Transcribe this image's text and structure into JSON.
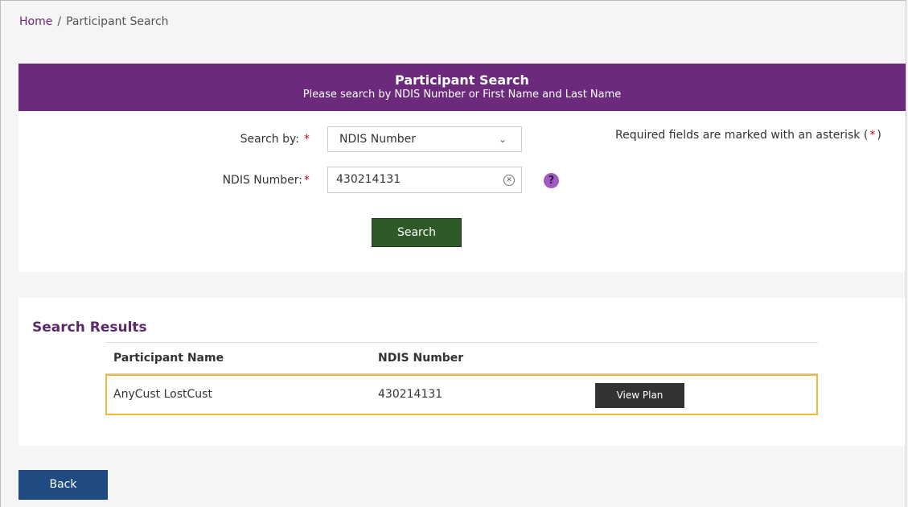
{
  "breadcrumb": {
    "home": "Home",
    "separator": "/",
    "current": "Participant Search"
  },
  "search_panel": {
    "title": "Participant Search",
    "subtitle": "Please search by NDIS Number or First Name and Last Name",
    "search_by_label": "Search by:",
    "search_by_value": "NDIS Number",
    "ndis_label": "NDIS Number:",
    "ndis_value": "430214131",
    "required_asterisk": "*",
    "required_note_prefix": "Required fields are marked with an asterisk (",
    "required_note_suffix": ")",
    "help_glyph": "?",
    "search_button": "Search"
  },
  "results": {
    "title": "Search Results",
    "columns": [
      "Participant Name",
      "NDIS Number"
    ],
    "rows": [
      {
        "name": "AnyCust LostCust",
        "ndis": "430214131",
        "action": "View Plan"
      }
    ]
  },
  "back_button": "Back",
  "colors": {
    "header_purple": "#6b2a7b",
    "search_green": "#2e5a27",
    "back_blue": "#1f4b82",
    "highlight": "#f0b93a",
    "required_red": "#d0021b"
  },
  "icons": {
    "select": "chevron-down-icon",
    "clear": "clear-icon",
    "help": "help-icon"
  }
}
